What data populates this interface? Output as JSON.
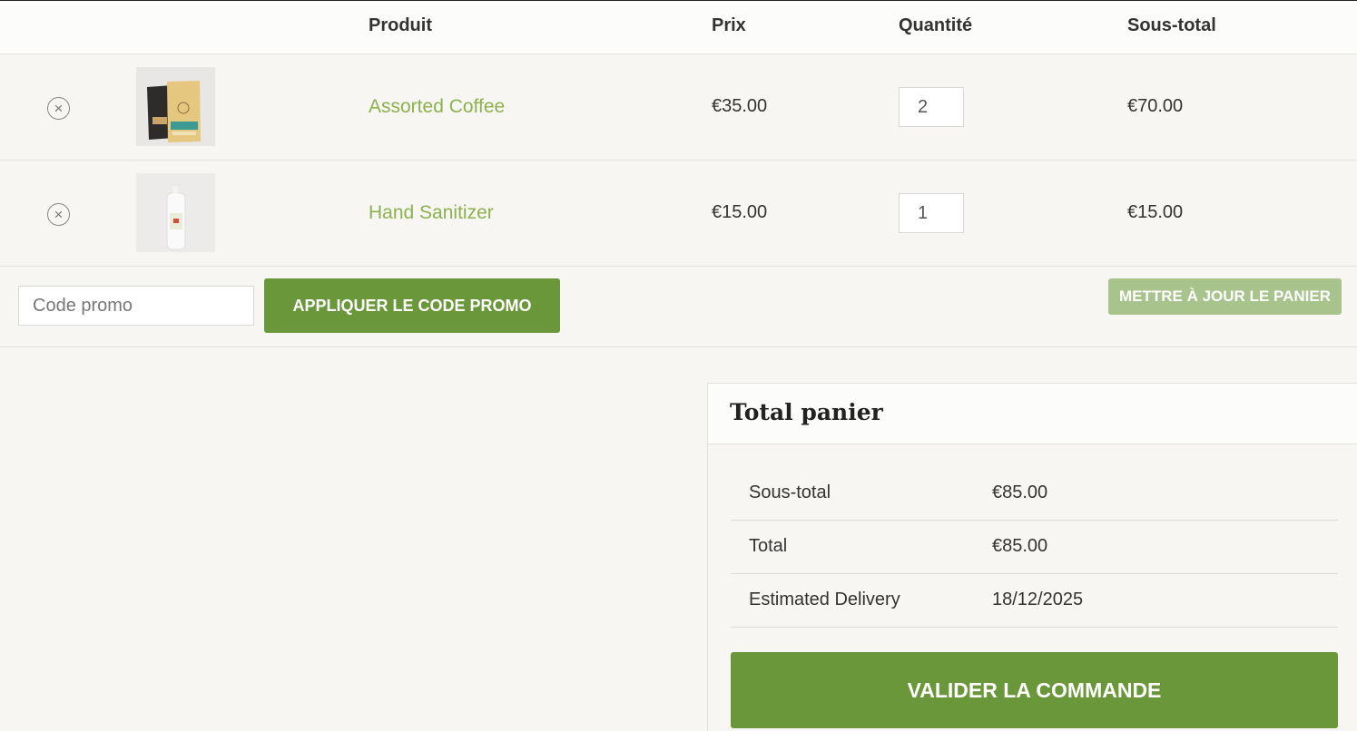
{
  "cart": {
    "columns": {
      "product": "Produit",
      "price": "Prix",
      "quantity": "Quantité",
      "subtotal": "Sous-total"
    },
    "items": [
      {
        "name": "Assorted Coffee",
        "price": "€35.00",
        "quantity": "2",
        "subtotal": "€70.00",
        "remove_icon": "circle-x-icon",
        "thumbnail": "coffee-bags-thumbnail"
      },
      {
        "name": "Hand Sanitizer",
        "price": "€15.00",
        "quantity": "1",
        "subtotal": "€15.00",
        "remove_icon": "circle-x-icon",
        "thumbnail": "sanitizer-bottle-thumbnail"
      }
    ]
  },
  "actions": {
    "coupon_placeholder": "Code promo",
    "apply_label": "APPLIQUER LE CODE PROMO",
    "update_label": "METTRE À JOUR LE PANIER"
  },
  "totals": {
    "title": "Total panier",
    "rows": [
      {
        "label": "Sous-total",
        "value": "€85.00"
      },
      {
        "label": "Total",
        "value": "€85.00"
      },
      {
        "label": "Estimated Delivery",
        "value": "18/12/2025"
      }
    ],
    "checkout_label": "VALIDER LA COMMANDE"
  },
  "colors": {
    "accent": "#6a9739",
    "accent_disabled": "#a9c38d",
    "product_link": "#8bb24f",
    "background": "#f7f6f2"
  }
}
